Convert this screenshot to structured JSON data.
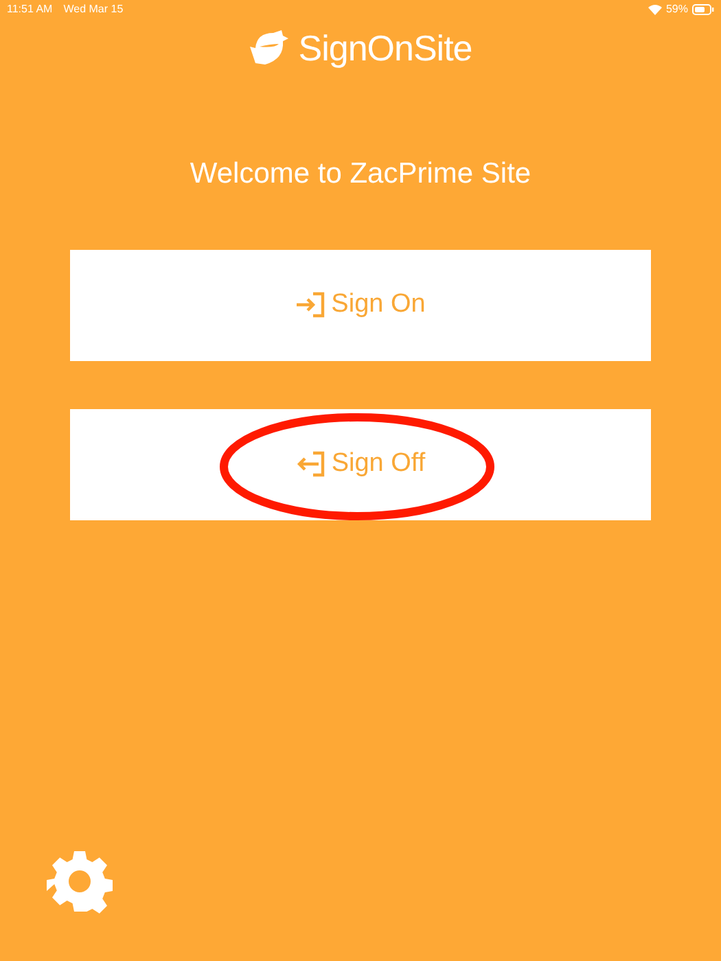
{
  "status_bar": {
    "time": "11:51 AM",
    "date": "Wed Mar 15",
    "battery": "59%"
  },
  "header": {
    "logo_text": "SignOnSite"
  },
  "welcome": "Welcome to ZacPrime Site",
  "buttons": [
    {
      "label": "Sign On",
      "kind": "enter",
      "circled": false
    },
    {
      "label": "Sign Off",
      "kind": "exit",
      "circled": true
    }
  ]
}
